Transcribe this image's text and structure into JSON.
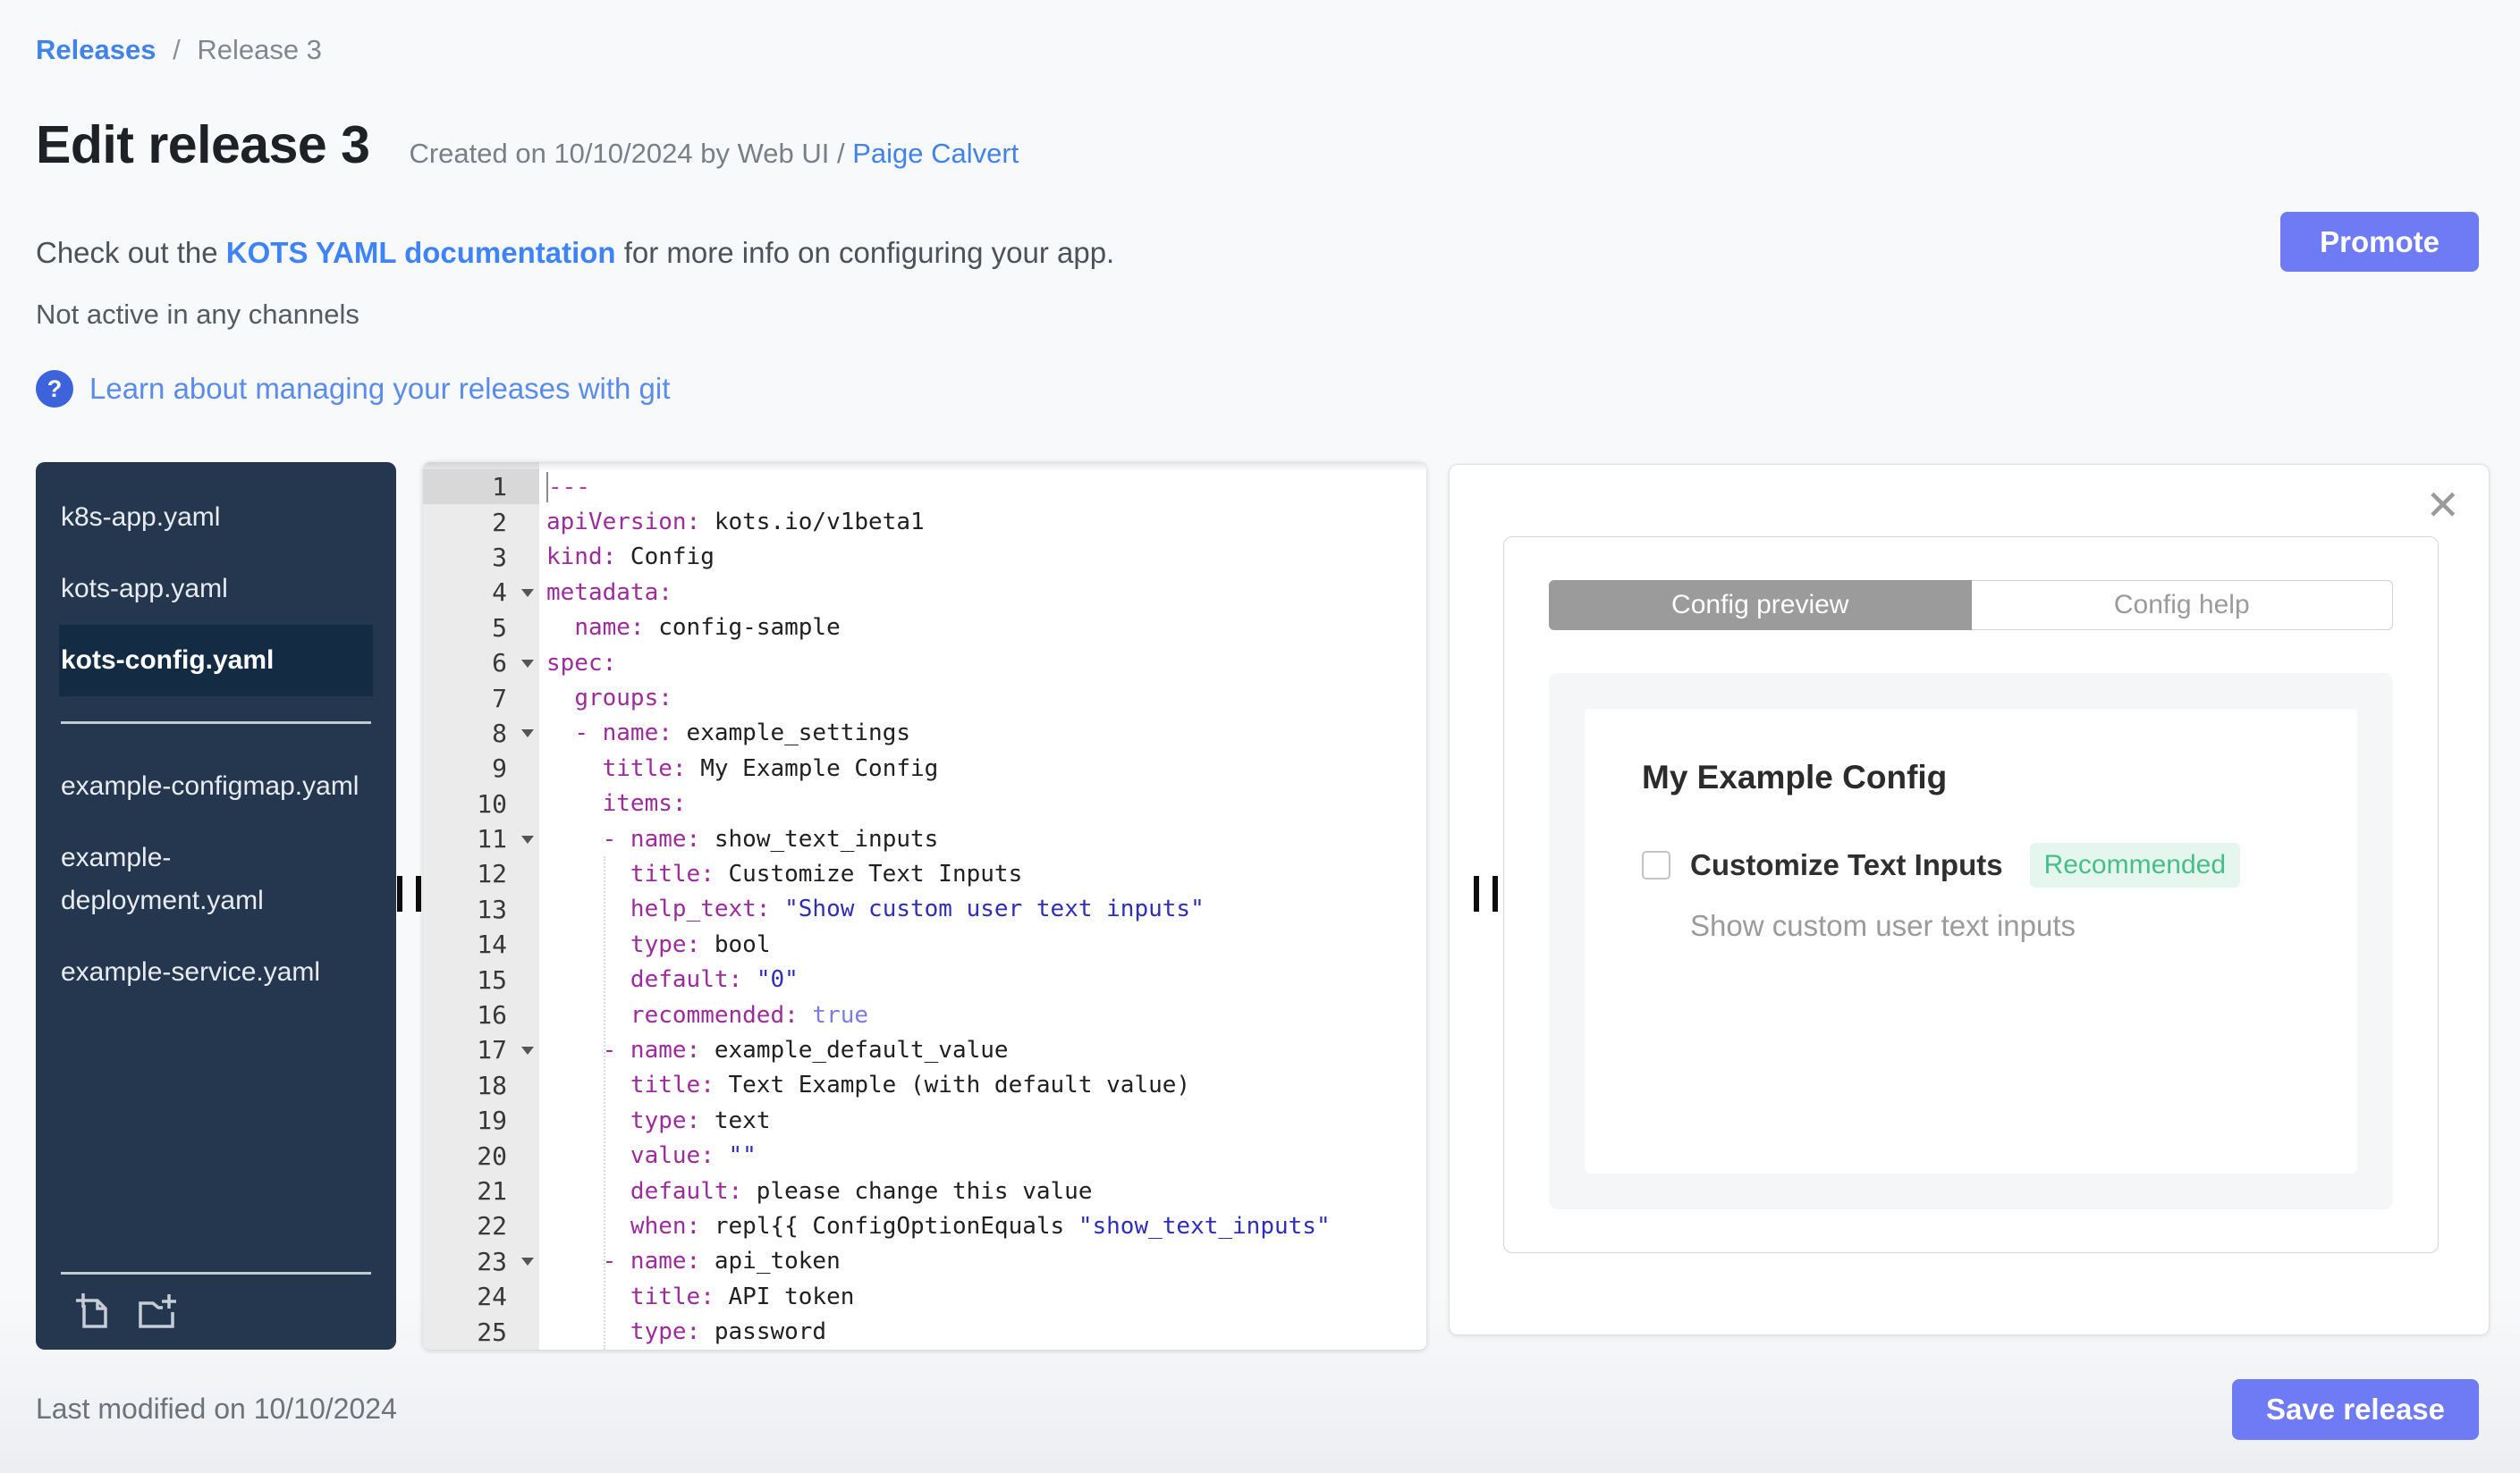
{
  "page": {
    "breadcrumb": {
      "link": "Releases",
      "separator": "/",
      "current": "Release 3"
    },
    "header": {
      "title": "Edit release 3",
      "created_prefix": "Created on 10/10/2024 by Web UI / ",
      "created_author": "Paige Calvert"
    },
    "docs_line": {
      "prefix": "Check out the ",
      "link": "KOTS YAML documentation",
      "suffix": " for more info on configuring your app."
    },
    "status_line": "Not active in any channels",
    "git_link": "Learn about managing your releases with git",
    "promote_button": "Promote",
    "footer": {
      "last_modified": "Last modified on 10/10/2024",
      "save_button": "Save release"
    }
  },
  "icons": {
    "question_mark": "?",
    "close_x": "✕",
    "new_file": "new-file-icon",
    "new_folder": "new-folder-icon"
  },
  "sidebar": {
    "files": [
      {
        "name": "k8s-app.yaml",
        "selected": false
      },
      {
        "name": "kots-app.yaml",
        "selected": false
      },
      {
        "name": "kots-config.yaml",
        "selected": true,
        "divider_after": true
      },
      {
        "name": "example-configmap.yaml",
        "selected": false
      },
      {
        "name": "example-deployment.yaml",
        "selected": false
      },
      {
        "name": "example-service.yaml",
        "selected": false
      }
    ]
  },
  "editor": {
    "lines": [
      {
        "n": 1,
        "active": true,
        "fold": false,
        "segs": [
          {
            "c": "doc",
            "t": "---"
          }
        ]
      },
      {
        "n": 2,
        "segs": [
          {
            "c": "key",
            "t": "apiVersion:"
          },
          {
            "c": "plain",
            "t": " kots.io/v1beta1"
          }
        ]
      },
      {
        "n": 3,
        "segs": [
          {
            "c": "key",
            "t": "kind:"
          },
          {
            "c": "plain",
            "t": " Config"
          }
        ]
      },
      {
        "n": 4,
        "fold": true,
        "segs": [
          {
            "c": "key",
            "t": "metadata:"
          }
        ]
      },
      {
        "n": 5,
        "segs": [
          {
            "c": "plain",
            "t": "  "
          },
          {
            "c": "key",
            "t": "name:"
          },
          {
            "c": "plain",
            "t": " config-sample"
          }
        ]
      },
      {
        "n": 6,
        "fold": true,
        "segs": [
          {
            "c": "key",
            "t": "spec:"
          }
        ]
      },
      {
        "n": 7,
        "segs": [
          {
            "c": "plain",
            "t": "  "
          },
          {
            "c": "key",
            "t": "groups:"
          }
        ]
      },
      {
        "n": 8,
        "fold": true,
        "segs": [
          {
            "c": "plain",
            "t": "  "
          },
          {
            "c": "key",
            "t": "- name:"
          },
          {
            "c": "plain",
            "t": " example_settings"
          }
        ]
      },
      {
        "n": 9,
        "segs": [
          {
            "c": "plain",
            "t": "    "
          },
          {
            "c": "key",
            "t": "title:"
          },
          {
            "c": "plain",
            "t": " My Example Config"
          }
        ]
      },
      {
        "n": 10,
        "segs": [
          {
            "c": "plain",
            "t": "    "
          },
          {
            "c": "key",
            "t": "items:"
          }
        ]
      },
      {
        "n": 11,
        "fold": true,
        "segs": [
          {
            "c": "plain",
            "t": "    "
          },
          {
            "c": "key",
            "t": "- name:"
          },
          {
            "c": "plain",
            "t": " show_text_inputs"
          }
        ]
      },
      {
        "n": 12,
        "segs": [
          {
            "c": "plain",
            "t": "      "
          },
          {
            "c": "key",
            "t": "title:"
          },
          {
            "c": "plain",
            "t": " Customize Text Inputs"
          }
        ]
      },
      {
        "n": 13,
        "segs": [
          {
            "c": "plain",
            "t": "      "
          },
          {
            "c": "key",
            "t": "help_text:"
          },
          {
            "c": "plain",
            "t": " "
          },
          {
            "c": "str",
            "t": "\"Show custom user text inputs\""
          }
        ]
      },
      {
        "n": 14,
        "segs": [
          {
            "c": "plain",
            "t": "      "
          },
          {
            "c": "key",
            "t": "type:"
          },
          {
            "c": "plain",
            "t": " bool"
          }
        ]
      },
      {
        "n": 15,
        "segs": [
          {
            "c": "plain",
            "t": "      "
          },
          {
            "c": "key",
            "t": "default:"
          },
          {
            "c": "plain",
            "t": " "
          },
          {
            "c": "str",
            "t": "\"0\""
          }
        ]
      },
      {
        "n": 16,
        "segs": [
          {
            "c": "plain",
            "t": "      "
          },
          {
            "c": "key",
            "t": "recommended:"
          },
          {
            "c": "plain",
            "t": " "
          },
          {
            "c": "bool",
            "t": "true"
          }
        ]
      },
      {
        "n": 17,
        "fold": true,
        "segs": [
          {
            "c": "plain",
            "t": "    "
          },
          {
            "c": "key",
            "t": "- name:"
          },
          {
            "c": "plain",
            "t": " example_default_value"
          }
        ]
      },
      {
        "n": 18,
        "segs": [
          {
            "c": "plain",
            "t": "      "
          },
          {
            "c": "key",
            "t": "title:"
          },
          {
            "c": "plain",
            "t": " Text Example (with default value)"
          }
        ]
      },
      {
        "n": 19,
        "segs": [
          {
            "c": "plain",
            "t": "      "
          },
          {
            "c": "key",
            "t": "type:"
          },
          {
            "c": "plain",
            "t": " text"
          }
        ]
      },
      {
        "n": 20,
        "segs": [
          {
            "c": "plain",
            "t": "      "
          },
          {
            "c": "key",
            "t": "value:"
          },
          {
            "c": "plain",
            "t": " "
          },
          {
            "c": "str",
            "t": "\"\""
          }
        ]
      },
      {
        "n": 21,
        "segs": [
          {
            "c": "plain",
            "t": "      "
          },
          {
            "c": "key",
            "t": "default:"
          },
          {
            "c": "plain",
            "t": " please change this value"
          }
        ]
      },
      {
        "n": 22,
        "segs": [
          {
            "c": "plain",
            "t": "      "
          },
          {
            "c": "key",
            "t": "when:"
          },
          {
            "c": "plain",
            "t": " repl{{ ConfigOptionEquals "
          },
          {
            "c": "str",
            "t": "\"show_text_inputs\""
          }
        ]
      },
      {
        "n": 23,
        "fold": true,
        "segs": [
          {
            "c": "plain",
            "t": "    "
          },
          {
            "c": "key",
            "t": "- name:"
          },
          {
            "c": "plain",
            "t": " api_token"
          }
        ]
      },
      {
        "n": 24,
        "segs": [
          {
            "c": "plain",
            "t": "      "
          },
          {
            "c": "key",
            "t": "title:"
          },
          {
            "c": "plain",
            "t": " API token"
          }
        ]
      },
      {
        "n": 25,
        "segs": [
          {
            "c": "plain",
            "t": "      "
          },
          {
            "c": "key",
            "t": "type:"
          },
          {
            "c": "plain",
            "t": " password"
          }
        ]
      }
    ]
  },
  "preview": {
    "tabs": [
      {
        "label": "Config preview",
        "active": true
      },
      {
        "label": "Config help",
        "active": false
      }
    ],
    "group_title": "My Example Config",
    "item": {
      "checked": false,
      "label": "Customize Text Inputs",
      "badge": "Recommended",
      "help": "Show custom user text inputs"
    }
  },
  "colors": {
    "accent_indigo": "#6E7BF5",
    "link_blue": "#4283E8",
    "docs_link_blue": "#3F83F8",
    "help_link_blue": "#5A8CEC",
    "help_icon_blue": "#3D63DC",
    "sidebar_bg": "#24374E",
    "sidebar_selected_bg": "#142B44",
    "tab_active_gray": "#9B9B9B",
    "badge_green_text": "#47BE8A",
    "badge_green_bg": "#E4F6ED",
    "yaml_key": "#9C2C9C",
    "yaml_string": "#2E2EB8",
    "yaml_bool": "#7C7CE0",
    "yaml_doc_separator": "#C0399B"
  }
}
